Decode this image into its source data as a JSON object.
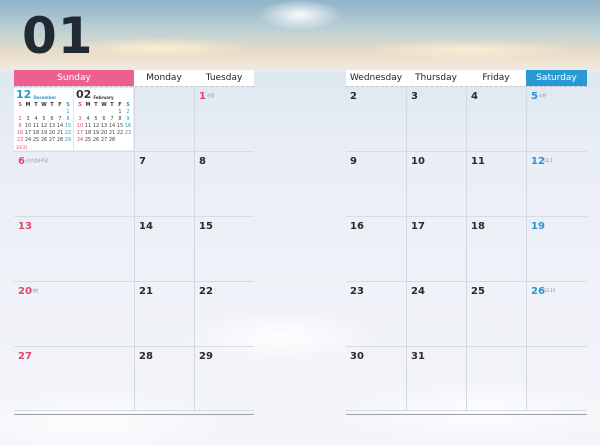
{
  "month_number": "01",
  "colors": {
    "sunday": "#ec5f8f",
    "saturday": "#2799d3",
    "text": "#2a2a2a"
  },
  "left_headers": [
    "Sunday",
    "Monday",
    "Tuesday"
  ],
  "right_headers": [
    "Wednesday",
    "Thursday",
    "Friday",
    "Saturday"
  ],
  "mini_calendars": [
    {
      "number": "12",
      "name": "December",
      "weekdays": [
        "S",
        "M",
        "T",
        "W",
        "T",
        "F",
        "S"
      ],
      "rows": [
        [
          "",
          "",
          "",
          "",
          "",
          "",
          "1"
        ],
        [
          "2",
          "3",
          "4",
          "5",
          "6",
          "7",
          "8"
        ],
        [
          "9",
          "10",
          "11",
          "12",
          "13",
          "14",
          "15"
        ],
        [
          "16",
          "17",
          "18",
          "19",
          "20",
          "21",
          "22"
        ],
        [
          "23",
          "24",
          "25",
          "26",
          "27",
          "28",
          "29"
        ],
        [
          "30/31",
          "",
          "",
          "",
          "",
          "",
          ""
        ]
      ]
    },
    {
      "number": "02",
      "name": "February",
      "weekdays": [
        "S",
        "M",
        "T",
        "W",
        "T",
        "F",
        "S"
      ],
      "rows": [
        [
          "",
          "",
          "",
          "",
          "",
          "1",
          "2"
        ],
        [
          "3",
          "4",
          "5",
          "6",
          "7",
          "8",
          "9"
        ],
        [
          "10",
          "11",
          "12",
          "13",
          "14",
          "15",
          "16"
        ],
        [
          "17",
          "18",
          "19",
          "20",
          "21",
          "22",
          "23"
        ],
        [
          "24",
          "25",
          "26",
          "27",
          "28",
          "",
          ""
        ],
        [
          "",
          "",
          "",
          "",
          "",
          "",
          ""
        ]
      ]
    }
  ],
  "left_weeks": [
    [
      {
        "day": "",
        "note": ""
      },
      {
        "day": "",
        "note": ""
      },
      {
        "day": "1",
        "note": "신정"
      }
    ],
    [
      {
        "day": "6",
        "note": "신년감사주일"
      },
      {
        "day": "7",
        "note": ""
      },
      {
        "day": "8",
        "note": ""
      }
    ],
    [
      {
        "day": "13",
        "note": ""
      },
      {
        "day": "14",
        "note": ""
      },
      {
        "day": "15",
        "note": ""
      }
    ],
    [
      {
        "day": "20",
        "note": "대한"
      },
      {
        "day": "21",
        "note": ""
      },
      {
        "day": "22",
        "note": ""
      }
    ],
    [
      {
        "day": "27",
        "note": ""
      },
      {
        "day": "28",
        "note": ""
      },
      {
        "day": "29",
        "note": ""
      }
    ]
  ],
  "right_weeks": [
    [
      {
        "day": "2",
        "note": ""
      },
      {
        "day": "3",
        "note": ""
      },
      {
        "day": "4",
        "note": ""
      },
      {
        "day": "5",
        "note": "소한"
      }
    ],
    [
      {
        "day": "9",
        "note": ""
      },
      {
        "day": "10",
        "note": ""
      },
      {
        "day": "11",
        "note": ""
      },
      {
        "day": "12",
        "note": "12.1"
      }
    ],
    [
      {
        "day": "16",
        "note": ""
      },
      {
        "day": "17",
        "note": ""
      },
      {
        "day": "18",
        "note": ""
      },
      {
        "day": "19",
        "note": ""
      }
    ],
    [
      {
        "day": "23",
        "note": ""
      },
      {
        "day": "24",
        "note": ""
      },
      {
        "day": "25",
        "note": ""
      },
      {
        "day": "26",
        "note": "12.15"
      }
    ],
    [
      {
        "day": "30",
        "note": ""
      },
      {
        "day": "31",
        "note": ""
      },
      {
        "day": "",
        "note": ""
      },
      {
        "day": "",
        "note": ""
      }
    ]
  ]
}
